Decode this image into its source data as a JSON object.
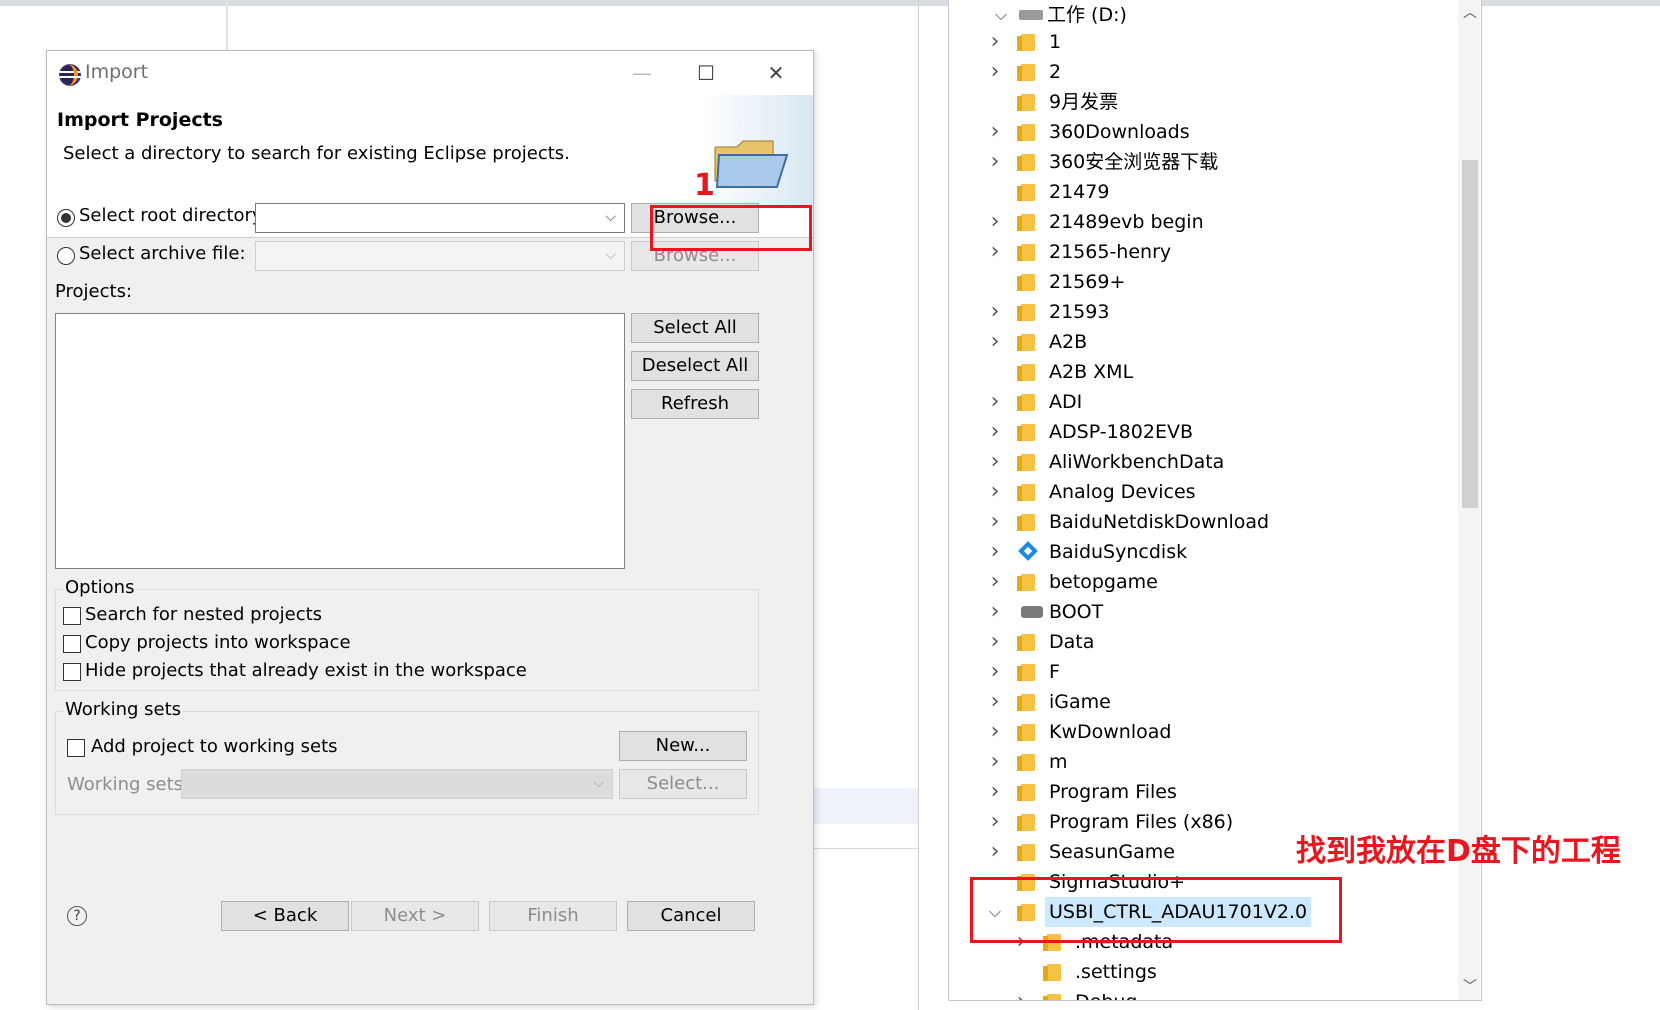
{
  "dialog": {
    "title": "Import",
    "header_title": "Import Projects",
    "header_desc": "Select a directory to search for existing Eclipse projects.",
    "root_dir_label": "Select root directory:",
    "archive_label": "Select archive file:",
    "root_dir_value": "",
    "archive_value": "",
    "browse_label": "Browse...",
    "browse2_label": "Browse...",
    "projects_label": "Projects:",
    "select_all": "Select All",
    "deselect_all": "Deselect All",
    "refresh": "Refresh",
    "options_legend": "Options",
    "opt_nested": "Search for nested projects",
    "opt_copy": "Copy projects into workspace",
    "opt_hide": "Hide projects that already exist in the workspace",
    "ws_legend": "Working sets",
    "ws_add": "Add project to working sets",
    "ws_new": "New...",
    "ws_sets_label": "Working sets:",
    "ws_select": "Select...",
    "back": "< Back",
    "next": "Next >",
    "finish": "Finish",
    "cancel": "Cancel",
    "help": "?"
  },
  "annotations": {
    "step_number": "1",
    "note": "找到我放在D盘下的工程"
  },
  "tree": {
    "drive": "工作 (D:)",
    "items": [
      {
        "label": "1",
        "expandable": true
      },
      {
        "label": "2",
        "expandable": true
      },
      {
        "label": "9月发票",
        "expandable": false
      },
      {
        "label": "360Downloads",
        "expandable": true
      },
      {
        "label": "360安全浏览器下载",
        "expandable": true
      },
      {
        "label": "21479",
        "expandable": false
      },
      {
        "label": "21489evb begin",
        "expandable": true
      },
      {
        "label": "21565-henry",
        "expandable": true
      },
      {
        "label": "21569+",
        "expandable": false
      },
      {
        "label": "21593",
        "expandable": true
      },
      {
        "label": "A2B",
        "expandable": true
      },
      {
        "label": "A2B XML",
        "expandable": false
      },
      {
        "label": "ADI",
        "expandable": true
      },
      {
        "label": "ADSP-1802EVB",
        "expandable": true
      },
      {
        "label": "AliWorkbenchData",
        "expandable": true
      },
      {
        "label": "Analog Devices",
        "expandable": true
      },
      {
        "label": "BaiduNetdiskDownload",
        "expandable": true
      },
      {
        "label": "BaiduSyncdisk",
        "expandable": true,
        "icon": "baidu-sync-icon"
      },
      {
        "label": "betopgame",
        "expandable": true
      },
      {
        "label": "BOOT",
        "expandable": true,
        "icon": "drive-icon"
      },
      {
        "label": "Data",
        "expandable": true
      },
      {
        "label": "F",
        "expandable": true
      },
      {
        "label": "iGame",
        "expandable": true
      },
      {
        "label": "KwDownload",
        "expandable": true
      },
      {
        "label": "m",
        "expandable": true
      },
      {
        "label": "Program Files",
        "expandable": true
      },
      {
        "label": "Program Files (x86)",
        "expandable": true
      },
      {
        "label": "SeasunGame",
        "expandable": true
      },
      {
        "label": "SigmaStudio+",
        "expandable": false
      },
      {
        "label": "USBI_CTRL_ADAU1701V2.0",
        "expandable": true,
        "expanded": true,
        "selected": true
      }
    ],
    "children": [
      ".metadata",
      ".settings",
      "Debug"
    ]
  },
  "colors": {
    "annotation_red": "#e8171f",
    "selection": "#cce8ff",
    "folder": "#f5c242"
  }
}
